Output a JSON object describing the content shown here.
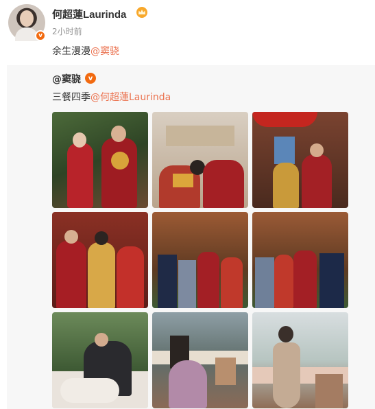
{
  "post": {
    "username": "何超蓮Laurinda",
    "time": "2小时前",
    "text_prefix": "余生漫漫",
    "mention": "@窦骁",
    "verified_badge": "v",
    "crown_icon": "crown-icon",
    "accent_color": "#eb7350"
  },
  "repost": {
    "author": "@窦骁",
    "text_prefix": "三餐四季",
    "mention": "@何超蓮Laurinda",
    "verified_badge": "v",
    "photos": [
      {
        "name": "couple-red-wedding-photo"
      },
      {
        "name": "ceremony-bow-photo"
      },
      {
        "name": "red-umbrella-entrance-photo"
      },
      {
        "name": "family-seated-photo"
      },
      {
        "name": "family-group-photo"
      },
      {
        "name": "family-group-photo-2"
      },
      {
        "name": "lace-dress-couple-photo"
      },
      {
        "name": "greenhouse-dining-couple-photo"
      },
      {
        "name": "bride-greenhouse-photo"
      }
    ]
  }
}
